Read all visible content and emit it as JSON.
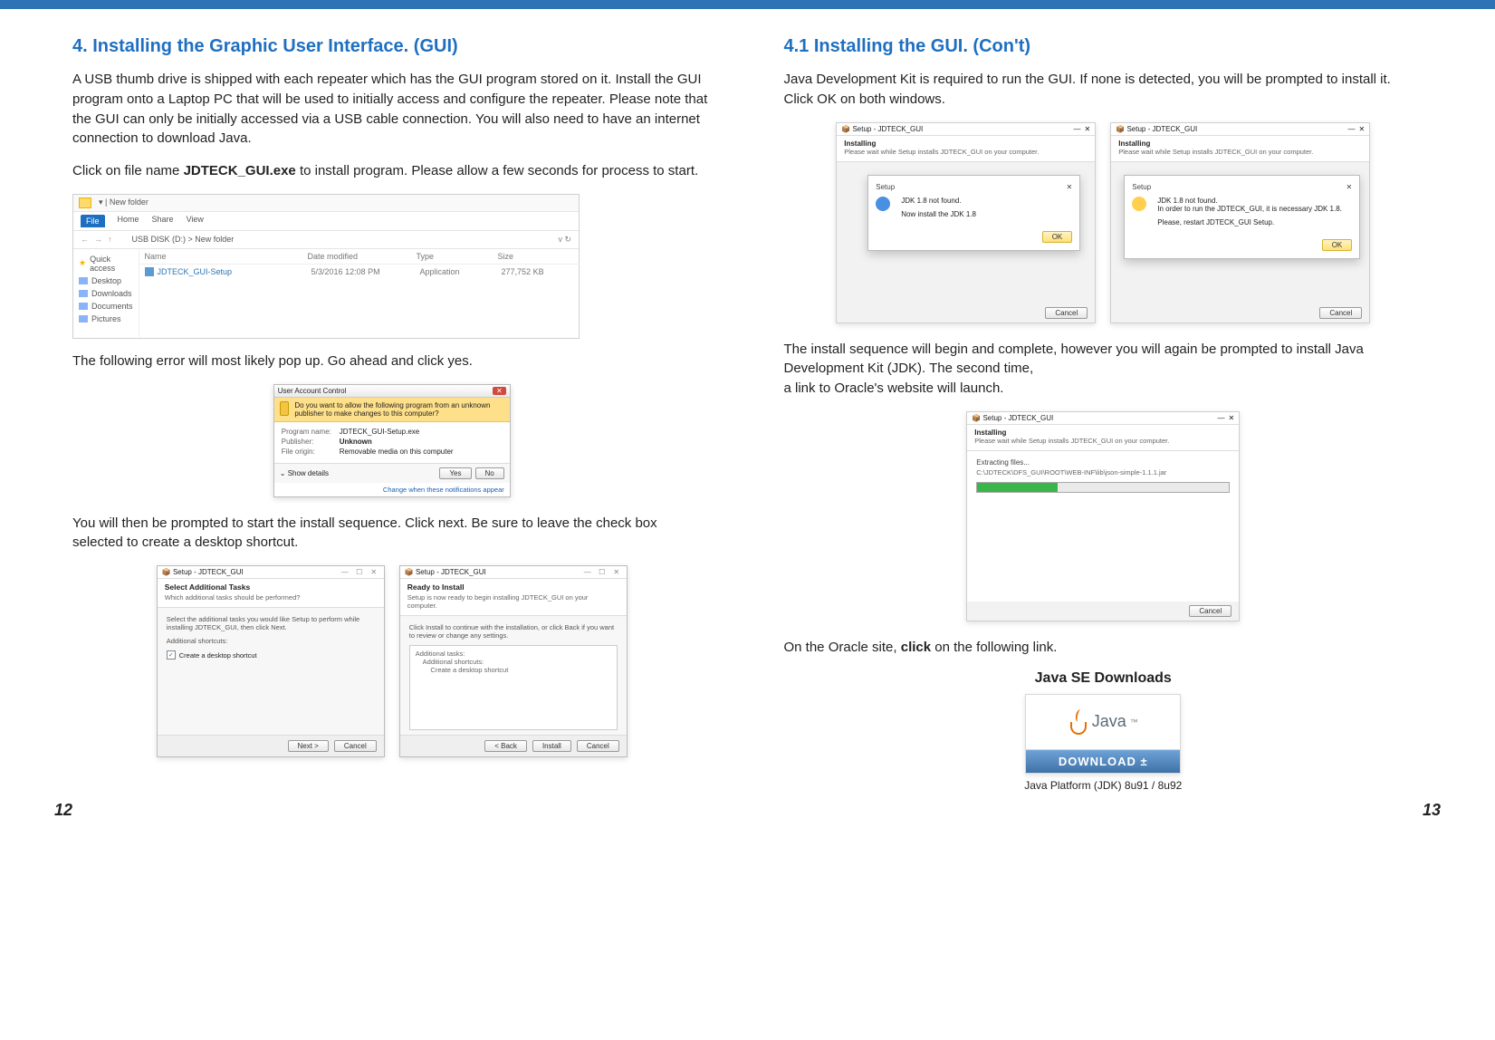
{
  "left": {
    "heading": "4. Installing the Graphic User Interface. (GUI)",
    "intro": "A USB thumb drive is shipped with each repeater which has the GUI program stored on it. Install the GUI program onto a Laptop PC that will be used to initially access and configure the repeater. Please note that the GUI can only be initially accessed via a USB cable connection. You will also need to have an internet connection to download Java.",
    "click_line_a": "Click on file name ",
    "click_bold": "JDTECK_GUI.exe",
    "click_line_b": " to install program. Please allow a few seconds for process to start.",
    "after_explorer": "The following error will most likely pop up. Go ahead and click yes.",
    "after_uac": "You will then be prompted to start the install sequence. Click next. Be sure to leave the check box selected to create a desktop shortcut.",
    "page_no": "12"
  },
  "right": {
    "heading": "4.1 Installing the GUI. (Con't)",
    "intro": "Java Development Kit is required to run the GUI. If none is detected, you will be prompted to install it. Click OK on both windows.",
    "after_jdk": "The install sequence will begin and complete, however you will again be prompted to install Java Development Kit (JDK). The second time,\na link to Oracle's website will launch.",
    "oracle_line_a": "On the Oracle site, ",
    "oracle_bold": "click",
    "oracle_line_b": " on the following link.",
    "java_title": "Java SE Downloads",
    "java_word": "Java",
    "java_btn": "DOWNLOAD ±",
    "java_caption": "Java Platform (JDK) 8u91 / 8u92",
    "page_no": "13"
  },
  "explorer": {
    "newfolder": "New folder",
    "ribbon": {
      "file": "File",
      "home": "Home",
      "share": "Share",
      "view": "View"
    },
    "path": "USB DISK (D:)  >  New folder",
    "refresh": "↻",
    "side": {
      "quick": "Quick access",
      "desktop": "Desktop",
      "downloads": "Downloads",
      "documents": "Documents",
      "pictures": "Pictures"
    },
    "cols": {
      "name": "Name",
      "date": "Date modified",
      "type": "Type",
      "size": "Size"
    },
    "row": {
      "name": "JDTECK_GUI-Setup",
      "date": "5/3/2016 12:08 PM",
      "type": "Application",
      "size": "277,752 KB"
    }
  },
  "uac": {
    "title": "User Account Control",
    "warn": "Do you want to allow the following program from an unknown publisher to make changes to this computer?",
    "rows": {
      "pn_k": "Program name:",
      "pn_v": "JDTECK_GUI-Setup.exe",
      "pub_k": "Publisher:",
      "pub_v": "Unknown",
      "fo_k": "File origin:",
      "fo_v": "Removable media on this computer"
    },
    "show_details": "Show details",
    "yes": "Yes",
    "no": "No",
    "link": "Change when these notifications appear"
  },
  "wiz1": {
    "title": "Setup - JDTECK_GUI",
    "h1": "Select Additional Tasks",
    "h2": "Which additional tasks should be performed?",
    "note": "Select the additional tasks you would like Setup to perform while installing JDTECK_GUI, then click Next.",
    "addl": "Additional shortcuts:",
    "cb": "Create a desktop shortcut",
    "next": "Next >",
    "cancel": "Cancel"
  },
  "wiz2": {
    "title": "Setup - JDTECK_GUI",
    "h1": "Ready to Install",
    "h2": "Setup is now ready to begin installing JDTECK_GUI on your computer.",
    "note": "Click Install to continue with the installation, or click Back if you want to review or change any settings.",
    "list": "Additional tasks:\n    Additional shortcuts:\n        Create a desktop shortcut",
    "back": "< Back",
    "install": "Install",
    "cancel": "Cancel"
  },
  "jdk1": {
    "title": "Setup - JDTECK_GUI",
    "h1": "Installing",
    "h2": "Please wait while Setup installs JDTECK_GUI on your computer.",
    "modal_title": "Setup",
    "msg1": "JDK 1.8 not found.",
    "msg2": "Now install the JDK 1.8",
    "ok": "OK",
    "cancel": "Cancel"
  },
  "jdk2": {
    "title": "Setup - JDTECK_GUI",
    "h1": "Installing",
    "h2": "Please wait while Setup installs JDTECK_GUI on your computer.",
    "modal_title": "Setup",
    "msg1": "JDK 1.8 not found.",
    "msg2": "In order to run the JDTECK_GUI, it is necessary JDK 1.8.",
    "msg3": "Please, restart JDTECK_GUI Setup.",
    "ok": "OK",
    "cancel": "Cancel"
  },
  "prog": {
    "title": "Setup - JDTECK_GUI",
    "h1": "Installing",
    "h2": "Please wait while Setup installs JDTECK_GUI on your computer.",
    "lbl": "Extracting files...",
    "path": "C:\\JDTECK\\DFS_GUI\\ROOT\\WEB-INF\\lib\\json-simple-1.1.1.jar",
    "cancel": "Cancel"
  }
}
